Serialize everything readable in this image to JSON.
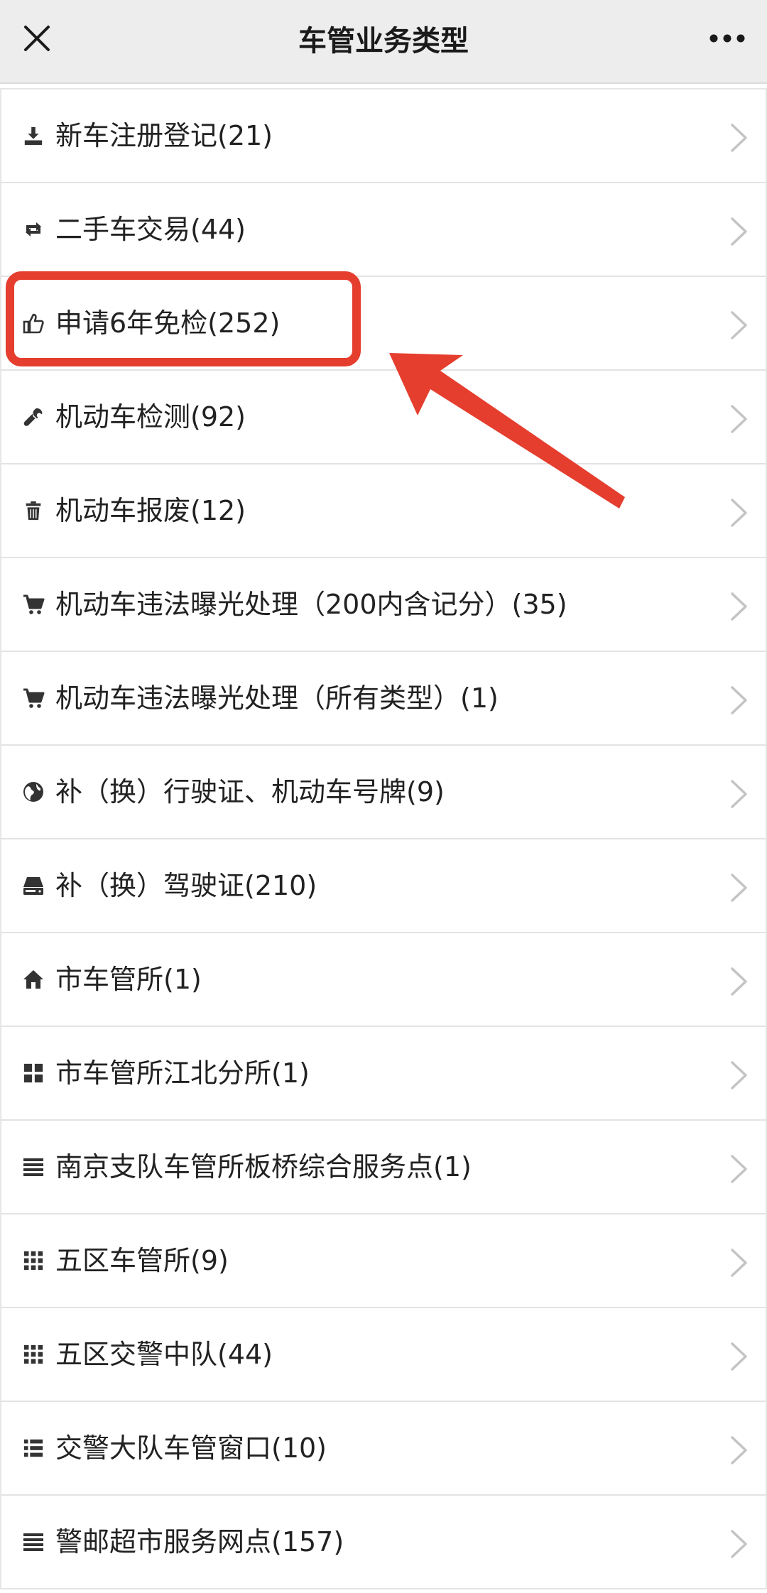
{
  "header": {
    "title": "车管业务类型"
  },
  "items": [
    {
      "icon": "download-icon",
      "label": "新车注册登记(21)"
    },
    {
      "icon": "retweet-icon",
      "label": "二手车交易(44)"
    },
    {
      "icon": "thumbs-up-icon",
      "label": "申请6年免检(252)"
    },
    {
      "icon": "wrench-icon",
      "label": "机动车检测(92)"
    },
    {
      "icon": "trash-icon",
      "label": "机动车报废(12)"
    },
    {
      "icon": "shopping-cart-icon",
      "label": "机动车违法曝光处理（200内含记分）(35)"
    },
    {
      "icon": "shopping-cart-icon",
      "label": "机动车违法曝光处理（所有类型）(1)"
    },
    {
      "icon": "globe-icon",
      "label": "补（换）行驶证、机动车号牌(9)"
    },
    {
      "icon": "hdd-icon",
      "label": "补（换）驾驶证(210)"
    },
    {
      "icon": "home-icon",
      "label": "市车管所(1)"
    },
    {
      "icon": "th-large-icon",
      "label": "市车管所江北分所(1)"
    },
    {
      "icon": "align-justify-icon",
      "label": "南京支队车管所板桥综合服务点(1)"
    },
    {
      "icon": "th-icon",
      "label": "五区车管所(9)"
    },
    {
      "icon": "th-icon",
      "label": "五区交警中队(44)"
    },
    {
      "icon": "list-icon",
      "label": "交警大队车管窗口(10)"
    },
    {
      "icon": "align-justify-icon",
      "label": "警邮超市服务网点(157)"
    }
  ],
  "annotation": {
    "highlighted_item": "申请6年免检(252)",
    "color": "#e53e2e"
  }
}
